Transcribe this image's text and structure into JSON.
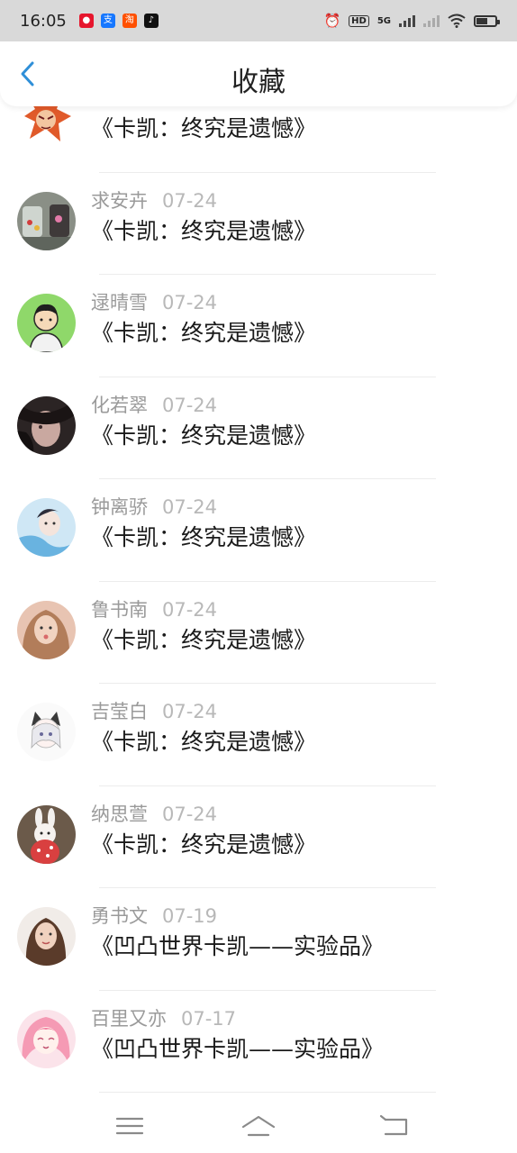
{
  "status_bar": {
    "time": "16:05",
    "notification_icons": [
      "weibo-icon",
      "alipay-icon",
      "taobao-icon",
      "tiktok-icon"
    ],
    "hd_label": "HD",
    "network_label": "5G"
  },
  "header": {
    "back_icon": "chevron-left-icon",
    "title": "收藏"
  },
  "favorites": [
    {
      "name": "",
      "date": "",
      "title": "《卡凯：终究是遗憾》"
    },
    {
      "name": "求安卉",
      "date": "07-24",
      "title": "《卡凯：终究是遗憾》"
    },
    {
      "name": "逯晴雪",
      "date": "07-24",
      "title": "《卡凯：终究是遗憾》"
    },
    {
      "name": "化若翠",
      "date": "07-24",
      "title": "《卡凯：终究是遗憾》"
    },
    {
      "name": "钟离骄",
      "date": "07-24",
      "title": "《卡凯：终究是遗憾》"
    },
    {
      "name": "鲁书南",
      "date": "07-24",
      "title": "《卡凯：终究是遗憾》"
    },
    {
      "name": "吉莹白",
      "date": "07-24",
      "title": "《卡凯：终究是遗憾》"
    },
    {
      "name": "纳思萱",
      "date": "07-24",
      "title": "《卡凯：终究是遗憾》"
    },
    {
      "name": "勇书文",
      "date": "07-19",
      "title": "《凹凸世界卡凯——实验品》"
    },
    {
      "name": "百里又亦",
      "date": "07-17",
      "title": "《凹凸世界卡凯——实验品》"
    }
  ],
  "bottom_nav": {
    "icons": [
      "menu-icon",
      "home-icon",
      "back-arrow-icon"
    ]
  },
  "colors": {
    "accent": "#2f8fd8",
    "status_bar_bg": "#d9d9d9",
    "name_text": "#9a9a9a",
    "title_text": "#1a1a1a"
  }
}
